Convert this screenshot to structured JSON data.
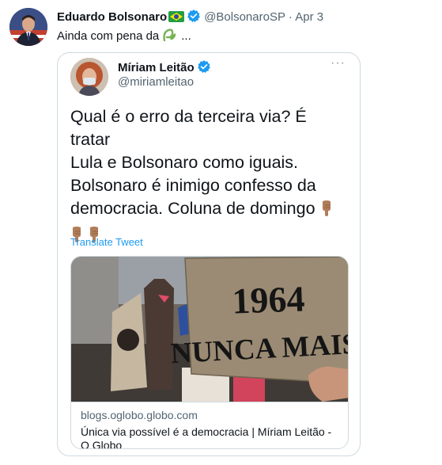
{
  "tweet": {
    "display_name": "Eduardo Bolsonaro",
    "flag_icon": "brazil-flag-emoji",
    "verified_icon": "verified-badge-icon",
    "handle": "@BolsonaroSP",
    "separator": "·",
    "time": "Apr 3",
    "text_before": "Ainda com pena da",
    "text_emoji": "green-leaf-emoji",
    "text_after": "..."
  },
  "quoted": {
    "display_name": "Míriam Leitão",
    "handle": "@miriamleitao",
    "more_label": "···",
    "body_line1": "Qual é o erro da terceira via? É tratar",
    "body_line2": "Lula e Bolsonaro como iguais.",
    "body_line3": "Bolsonaro é inimigo confesso da",
    "body_line4": "democracia. Coluna de domingo",
    "hand_emoji": "pointing-down-hand-emoji",
    "translate_label": "Translate Tweet",
    "card": {
      "sign_line1": "1964",
      "sign_line2": "NUNCA MAIS",
      "domain": "blogs.oglobo.globo.com",
      "title": "Única via possível é a democracia | Míriam Leitão - O Globo"
    }
  },
  "colors": {
    "link_blue": "#1d9bf0",
    "secondary_text": "#536471",
    "border": "#cfd9de",
    "text": "#0f1419"
  }
}
